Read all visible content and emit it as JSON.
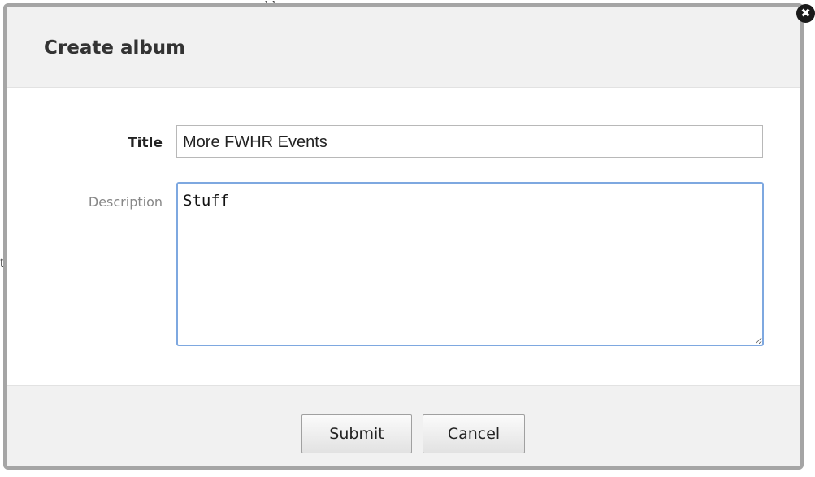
{
  "background": {
    "top_text": "; ,",
    "left_text": "t("
  },
  "dialog": {
    "title": "Create album",
    "close_symbol": "✖",
    "fields": {
      "title": {
        "label": "Title",
        "value": "More FWHR Events"
      },
      "description": {
        "label": "Description",
        "value": "Stuff"
      }
    },
    "buttons": {
      "submit": "Submit",
      "cancel": "Cancel"
    }
  },
  "colors": {
    "header_bg": "#f1f1f1",
    "dialog_border": "#a5a5a5",
    "textarea_focus_border": "#7ea8e0"
  }
}
